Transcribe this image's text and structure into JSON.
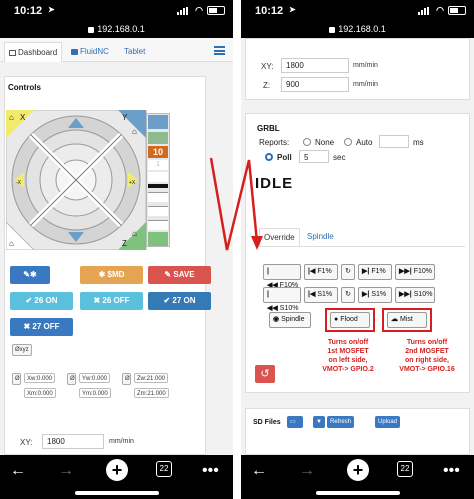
{
  "left": {
    "status": {
      "time": "10:12",
      "url": "192.168.0.1"
    },
    "tabs": [
      {
        "label": "Dashboard"
      },
      {
        "label": "FluidNC"
      },
      {
        "label": "Tablet"
      }
    ],
    "controls_title": "Controls",
    "jog": {
      "axis_y": "Y",
      "axis_x": "X",
      "axis_z": "Z",
      "plus_x": "+X",
      "minus_x": "-X",
      "step_labels": [
        "10",
        "1"
      ]
    },
    "buttons": {
      "md": "$MD",
      "save": "SAVE",
      "on26": "26 ON",
      "off26": "26 OFF",
      "on27": "27 ON",
      "off27": "27 OFF"
    },
    "chip_xyz": "Øxyz",
    "coords": {
      "xw": "Xw:0.000",
      "yw": "Yw:0.000",
      "zw": "Zw:21.000",
      "xm": "Xm:0.000",
      "ym": "Ym:0.000",
      "zm": "Zm:21.000"
    },
    "xy_label": "XY:",
    "xy_value": "1800",
    "xy_unit": "mm/min",
    "nav": {
      "tab_count": "22"
    }
  },
  "right": {
    "status": {
      "time": "10:12",
      "url": "192.168.0.1"
    },
    "xy": {
      "label": "XY:",
      "value": "1800",
      "unit": "mm/min"
    },
    "z": {
      "label": "Z:",
      "value": "900",
      "unit": "mm/min"
    },
    "grbl": {
      "title": "GRBL",
      "reports_label": "Reports:",
      "none_label": "None",
      "auto_label": "Auto",
      "ms_label": "ms",
      "poll_label": "Poll",
      "poll_value": "5",
      "sec_label": "sec"
    },
    "state": "IDLE",
    "override_tabs": [
      {
        "label": "Override"
      },
      {
        "label": "Spindle"
      }
    ],
    "override_rows": [
      [
        "F10%",
        "F1%",
        "F1%",
        "F10%"
      ],
      [
        "S10%",
        "S1%",
        "S1%",
        "S10%"
      ]
    ],
    "spindle_btn": "Spindle",
    "flood_btn": "Flood",
    "mist_btn": "Mist",
    "note_left": "Turns on/off\n1st MOSFET\non left side,\nVMOT-> GPIO.2",
    "note_right": "Turns on/off\n2nd MOSFET\non right side,\nVMOT-> GPIO.16",
    "sd": {
      "title": "SD Files",
      "refresh": "Refresh",
      "upload": "Upload"
    },
    "nav": {
      "tab_count": "22"
    }
  },
  "colors": {
    "annotation": "#d62020",
    "primary": "#3b78c2",
    "warning": "#e5a452",
    "danger": "#d9534f",
    "info": "#5bc0de"
  }
}
